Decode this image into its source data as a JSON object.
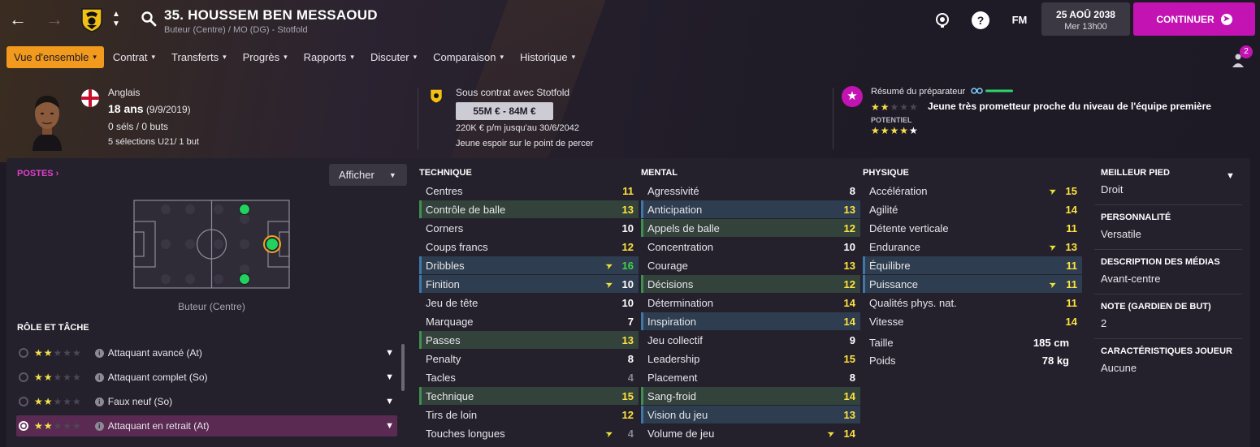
{
  "header": {
    "player_title": "35. HOUSSEM BEN MESSAOUD",
    "player_subtitle": "Buteur (Centre) / MO (DG) - Stotfold",
    "fm_label": "FM",
    "date_main": "25 AOÛ 2038",
    "date_sub": "Mer 13h00",
    "continue_label": "CONTINUER"
  },
  "menu": [
    {
      "label": "Vue d'ensemble",
      "active": true
    },
    {
      "label": "Contrat"
    },
    {
      "label": "Transferts"
    },
    {
      "label": "Progrès"
    },
    {
      "label": "Rapports"
    },
    {
      "label": "Discuter"
    },
    {
      "label": "Comparaison"
    },
    {
      "label": "Historique"
    }
  ],
  "notifications": {
    "count": "2"
  },
  "profile": {
    "nationality": "Anglais",
    "age": "18 ans",
    "dob": "(9/9/2019)",
    "caps": "0 séls / 0 buts",
    "u21": "5 sélections U21/ 1 but"
  },
  "contract": {
    "club_line": "Sous contrat avec Stotfold",
    "value_range": "55M € - 84M €",
    "wage": "220K € p/m jusqu'au 30/6/2042",
    "status": "Jeune espoir sur le point de percer"
  },
  "scout": {
    "label": "Résumé du préparateur",
    "ability_stars": 2,
    "summary": "Jeune très prometteur proche du niveau de l'équipe première",
    "potential_label": "POTENTIEL",
    "potential_stars": 4.5
  },
  "positions": {
    "label": "POSTES",
    "show_button": "Afficher",
    "position_name": "Buteur (Centre)"
  },
  "roles": {
    "title": "RÔLE ET TÂCHE",
    "items": [
      {
        "label": "Attaquant avancé (At)",
        "stars": 2,
        "selected": false
      },
      {
        "label": "Attaquant complet (So)",
        "stars": 2,
        "selected": false
      },
      {
        "label": "Faux neuf (So)",
        "stars": 2,
        "selected": false
      },
      {
        "label": "Attaquant en retrait (At)",
        "stars": 2,
        "selected": true
      }
    ]
  },
  "technique": {
    "title": "TECHNIQUE",
    "rows": [
      {
        "name": "Centres",
        "value": "11",
        "hl": "",
        "color": "yellow",
        "arrow": false
      },
      {
        "name": "Contrôle de balle",
        "value": "13",
        "hl": "green",
        "color": "yellow",
        "arrow": false
      },
      {
        "name": "Corners",
        "value": "10",
        "hl": "",
        "color": "white",
        "arrow": false
      },
      {
        "name": "Coups francs",
        "value": "12",
        "hl": "",
        "color": "yellow",
        "arrow": false
      },
      {
        "name": "Dribbles",
        "value": "16",
        "hl": "blue",
        "color": "green",
        "arrow": true
      },
      {
        "name": "Finition",
        "value": "10",
        "hl": "blue",
        "color": "white",
        "arrow": true
      },
      {
        "name": "Jeu de tête",
        "value": "10",
        "hl": "",
        "color": "white",
        "arrow": false
      },
      {
        "name": "Marquage",
        "value": "7",
        "hl": "",
        "color": "white",
        "arrow": false
      },
      {
        "name": "Passes",
        "value": "13",
        "hl": "green",
        "color": "yellow",
        "arrow": false
      },
      {
        "name": "Penalty",
        "value": "8",
        "hl": "",
        "color": "white",
        "arrow": false
      },
      {
        "name": "Tacles",
        "value": "4",
        "hl": "",
        "color": "grey",
        "arrow": false
      },
      {
        "name": "Technique",
        "value": "15",
        "hl": "green",
        "color": "yellow",
        "arrow": false
      },
      {
        "name": "Tirs de loin",
        "value": "12",
        "hl": "",
        "color": "yellow",
        "arrow": false
      },
      {
        "name": "Touches longues",
        "value": "4",
        "hl": "",
        "color": "grey",
        "arrow": true
      }
    ]
  },
  "mental": {
    "title": "MENTAL",
    "rows": [
      {
        "name": "Agressivité",
        "value": "8",
        "hl": "",
        "color": "white",
        "arrow": false
      },
      {
        "name": "Anticipation",
        "value": "13",
        "hl": "blue",
        "color": "yellow",
        "arrow": false
      },
      {
        "name": "Appels de balle",
        "value": "12",
        "hl": "green",
        "color": "yellow",
        "arrow": false
      },
      {
        "name": "Concentration",
        "value": "10",
        "hl": "",
        "color": "white",
        "arrow": false
      },
      {
        "name": "Courage",
        "value": "13",
        "hl": "",
        "color": "yellow",
        "arrow": false
      },
      {
        "name": "Décisions",
        "value": "12",
        "hl": "green",
        "color": "yellow",
        "arrow": false
      },
      {
        "name": "Détermination",
        "value": "14",
        "hl": "",
        "color": "yellow",
        "arrow": false
      },
      {
        "name": "Inspiration",
        "value": "14",
        "hl": "blue",
        "color": "yellow",
        "arrow": false
      },
      {
        "name": "Jeu collectif",
        "value": "9",
        "hl": "",
        "color": "white",
        "arrow": false
      },
      {
        "name": "Leadership",
        "value": "15",
        "hl": "",
        "color": "yellow",
        "arrow": false
      },
      {
        "name": "Placement",
        "value": "8",
        "hl": "",
        "color": "white",
        "arrow": false
      },
      {
        "name": "Sang-froid",
        "value": "14",
        "hl": "green",
        "color": "yellow",
        "arrow": false
      },
      {
        "name": "Vision du jeu",
        "value": "13",
        "hl": "blue",
        "color": "yellow",
        "arrow": false
      },
      {
        "name": "Volume de jeu",
        "value": "14",
        "hl": "",
        "color": "yellow",
        "arrow": true
      }
    ]
  },
  "physique": {
    "title": "PHYSIQUE",
    "rows": [
      {
        "name": "Accélération",
        "value": "15",
        "hl": "",
        "color": "yellow",
        "arrow": true
      },
      {
        "name": "Agilité",
        "value": "14",
        "hl": "",
        "color": "yellow",
        "arrow": false
      },
      {
        "name": "Détente verticale",
        "value": "11",
        "hl": "",
        "color": "yellow",
        "arrow": false
      },
      {
        "name": "Endurance",
        "value": "13",
        "hl": "",
        "color": "yellow",
        "arrow": true
      },
      {
        "name": "Équilibre",
        "value": "11",
        "hl": "blue",
        "color": "yellow",
        "arrow": false
      },
      {
        "name": "Puissance",
        "value": "11",
        "hl": "blue",
        "color": "yellow",
        "arrow": true
      },
      {
        "name": "Qualités phys. nat.",
        "value": "11",
        "hl": "",
        "color": "yellow",
        "arrow": false
      },
      {
        "name": "Vitesse",
        "value": "14",
        "hl": "",
        "color": "yellow",
        "arrow": false
      }
    ],
    "height_label": "Taille",
    "height_value": "185 cm",
    "weight_label": "Poids",
    "weight_value": "78 kg"
  },
  "sidebar": [
    {
      "title": "MEILLEUR PIED",
      "value": "Droit"
    },
    {
      "title": "PERSONNALITÉ",
      "value": "Versatile"
    },
    {
      "title": "DESCRIPTION DES MÉDIAS",
      "value": "Avant-centre"
    },
    {
      "title": "NOTE (GARDIEN DE BUT)",
      "value": "2"
    },
    {
      "title": "CARACTÉRISTIQUES JOUEUR",
      "value": "Aucune"
    }
  ],
  "colors": {
    "accent": "#c313b2",
    "menu_active": "#f29a1d",
    "value_yellow": "#ffe33d",
    "value_green": "#42d14a"
  }
}
